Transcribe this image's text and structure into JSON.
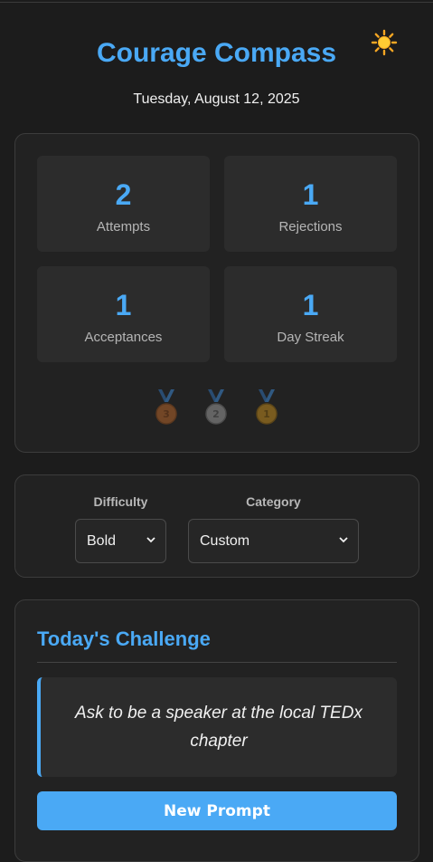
{
  "header": {
    "title": "Courage Compass",
    "date": "Tuesday, August 12, 2025",
    "theme_icon": "sun-icon"
  },
  "stats": [
    {
      "value": "2",
      "label": "Attempts"
    },
    {
      "value": "1",
      "label": "Rejections"
    },
    {
      "value": "1",
      "label": "Acceptances"
    },
    {
      "value": "1",
      "label": "Day Streak"
    }
  ],
  "medals": [
    {
      "name": "bronze-medal-icon",
      "number": "3"
    },
    {
      "name": "silver-medal-icon",
      "number": "2"
    },
    {
      "name": "gold-medal-icon",
      "number": "1"
    }
  ],
  "filters": {
    "difficulty_label": "Difficulty",
    "difficulty_value": "Bold",
    "category_label": "Category",
    "category_value": "Custom"
  },
  "challenge": {
    "title": "Today's Challenge",
    "prompt": "Ask to be a speaker at the local TEDx chapter",
    "button_label": "New Prompt"
  },
  "colors": {
    "accent": "#4aa9f5",
    "background": "#1c1c1c",
    "card": "#222222",
    "tile": "#2c2c2c"
  }
}
